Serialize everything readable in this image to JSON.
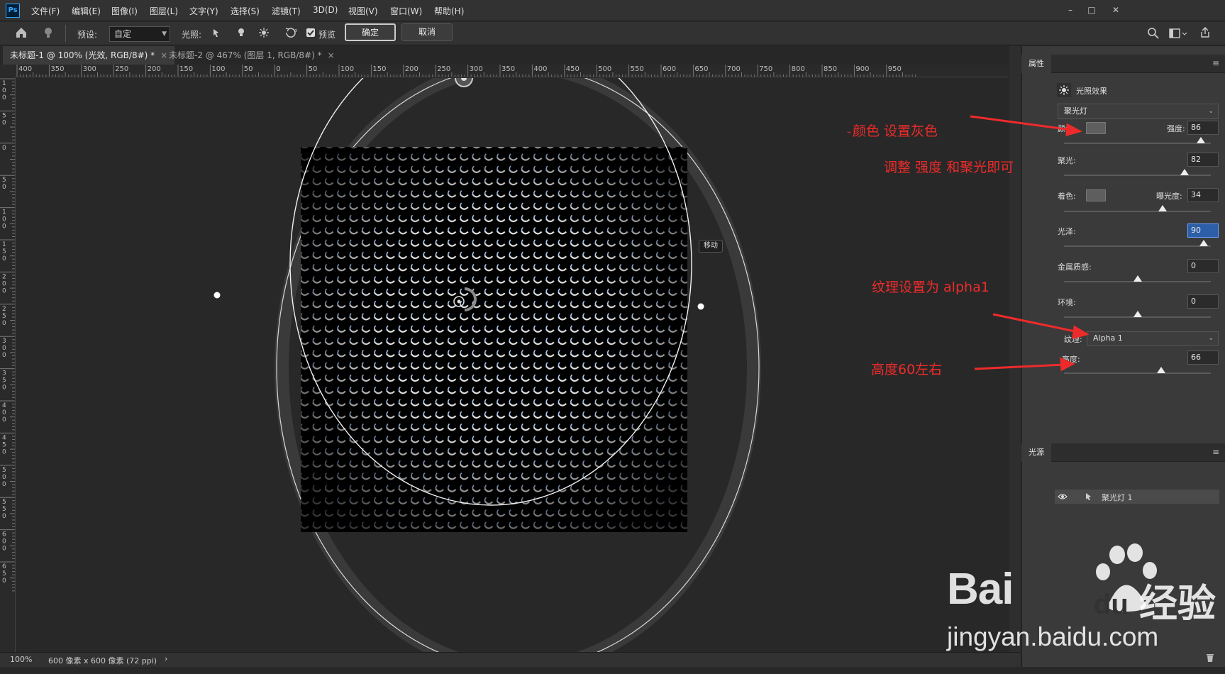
{
  "app": {
    "logo": "Ps"
  },
  "menu": [
    "文件(F)",
    "编辑(E)",
    "图像(I)",
    "图层(L)",
    "文字(Y)",
    "选择(S)",
    "滤镜(T)",
    "3D(D)",
    "视图(V)",
    "窗口(W)",
    "帮助(H)"
  ],
  "options": {
    "preset_label": "预设:",
    "preset_value": "自定",
    "light_label": "光照:",
    "preview_label": "预览",
    "preview_checked": true,
    "ok_label": "确定",
    "cancel_label": "取消"
  },
  "tabs": [
    {
      "label": "未标题-1 @ 100% (光效, RGB/8#) *",
      "active": true
    },
    {
      "label": "未标题-2 @ 467% (图层 1, RGB/8#) *",
      "active": false
    }
  ],
  "ruler": {
    "h_labels": [
      "400",
      "350",
      "300",
      "250",
      "200",
      "150",
      "100",
      "50",
      "0",
      "50",
      "100",
      "150",
      "200",
      "250",
      "300",
      "350",
      "400",
      "450",
      "500",
      "550",
      "600",
      "650",
      "700",
      "750",
      "800",
      "850",
      "900",
      "950"
    ],
    "v_labels": [
      "100",
      "50",
      "0",
      "50",
      "100",
      "150",
      "200",
      "250",
      "300",
      "350",
      "400",
      "450",
      "500",
      "550",
      "600",
      "650"
    ]
  },
  "canvas": {
    "move_tooltip": "移动"
  },
  "status": {
    "zoom": "100%",
    "doc_info": "600 像素 x 600 像素 (72 ppi)",
    "arrow": "›"
  },
  "properties": {
    "tab_label": "属性",
    "header": "光照效果",
    "light_type": "聚光灯",
    "color_label": "颜色:",
    "intensity_label": "强度:",
    "intensity_value": "86",
    "intensity": 86,
    "hotspot_label": "聚光:",
    "hotspot_value": "82",
    "hotspot": 82,
    "colorize_label": "着色:",
    "exposure_label": "曝光度:",
    "exposure_value": "34",
    "exposure": 34,
    "gloss_label": "光泽:",
    "gloss_value": "90",
    "gloss": 90,
    "metallic_label": "金属质感:",
    "metallic_value": "0",
    "metallic": 0,
    "ambience_label": "环境:",
    "ambience_value": "0",
    "ambience": 0,
    "texture_label": "纹理:",
    "texture_value": "Alpha 1",
    "height_label": "高度:",
    "height_value": "66",
    "height": 66
  },
  "lights_panel": {
    "tab_label": "光源",
    "item_label": "聚光灯 1"
  },
  "annotations": {
    "color_note": "颜色 设置灰色",
    "adjust_note": "调整 强度 和聚光即可",
    "texture_note": "纹理设置为 alpha1",
    "height_note": "高度60左右"
  },
  "watermark": {
    "brand": "Bai",
    "brand2": "du",
    "brand_cn": "经验",
    "url": "jingyan.baidu.com"
  },
  "colors": {
    "annotation": "#ee2b2b",
    "accent": "#31a8ff",
    "focus_field": "#2d5fa8"
  }
}
